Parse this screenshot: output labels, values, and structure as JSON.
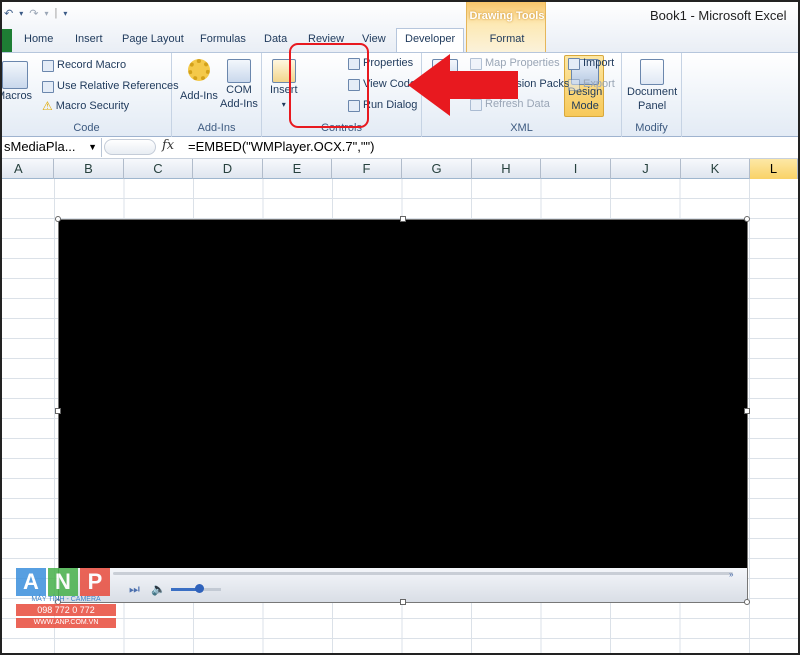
{
  "window": {
    "title": "Book1  -  Microsoft Excel"
  },
  "contextual_tab": {
    "label": "Drawing Tools",
    "tab": "Format"
  },
  "tabs": [
    "Home",
    "Insert",
    "Page Layout",
    "Formulas",
    "Data",
    "Review",
    "View",
    "Developer"
  ],
  "ribbon": {
    "code": {
      "label": "Code",
      "macros": "Macros",
      "record_macro": "Record Macro",
      "use_relative": "Use Relative References",
      "macro_security": "Macro Security"
    },
    "addins": {
      "label": "Add-Ins",
      "add_ins": "Add-Ins",
      "com_add_ins_1": "COM",
      "com_add_ins_2": "Add-Ins"
    },
    "controls": {
      "label": "Controls",
      "insert": "Insert",
      "design_mode_1": "Design",
      "design_mode_2": "Mode",
      "properties": "Properties",
      "view_code": "View Code",
      "run_dialog": "Run Dialog"
    },
    "xml": {
      "label": "XML",
      "map_properties": "Map Properties",
      "expansion_packs": "Expansion Packs",
      "refresh_data": "Refresh Data",
      "import": "Import",
      "export": "Export"
    },
    "modify": {
      "label": "Modify",
      "document_panel_1": "Document",
      "document_panel_2": "Panel"
    }
  },
  "formula_bar": {
    "name_box": "sMediaPla...",
    "fx": "fx",
    "formula": "=EMBED(\"WMPlayer.OCX.7\",\"\")"
  },
  "columns": [
    "A",
    "B",
    "C",
    "D",
    "E",
    "F",
    "G",
    "H",
    "I",
    "J",
    "K",
    "L"
  ],
  "selected_column": "L",
  "watermark": {
    "letters": [
      "A",
      "N",
      "P"
    ],
    "tagline": "MÁY TÍNH - CAMERA",
    "phone": "098 772 0 772",
    "web": "WWW.ANP.COM.VN"
  },
  "colors": {
    "accent": "#e8191f",
    "excel_green": "#1e7e34",
    "highlight": "#f7c95a"
  }
}
